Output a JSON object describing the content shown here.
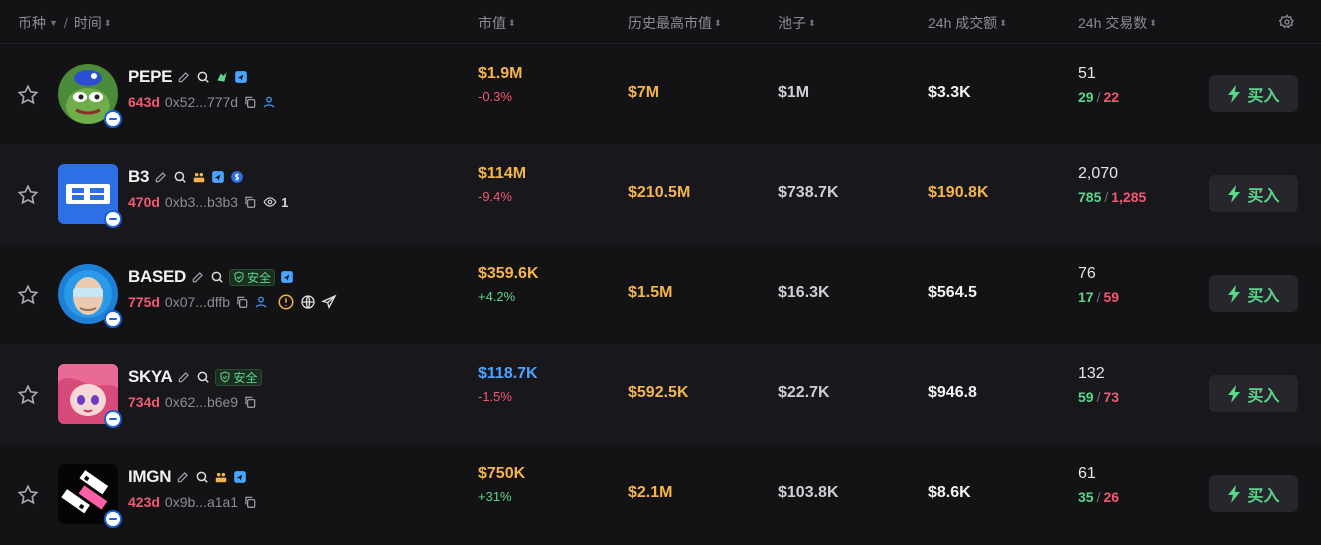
{
  "header": {
    "coin_label": "币种",
    "time_label": "时间",
    "mcap_label": "市值",
    "ath_label": "历史最高市值",
    "pool_label": "池子",
    "vol_label": "24h 成交额",
    "txns_label": "24h 交易数"
  },
  "rows": [
    {
      "symbol": "PEPE",
      "age": "643d",
      "address": "0x52...777d",
      "mcap": "$1.9M",
      "mcap_color": "#f5b54a",
      "change": "-0.3%",
      "change_dir": "down",
      "ath": "$7M",
      "pool": "$1M",
      "volume": "$3.3K",
      "volume_color": "#f2f2f2",
      "txns": "51",
      "buys": "29",
      "sells": "22",
      "buy_label": "买入"
    },
    {
      "symbol": "B3",
      "age": "470d",
      "address": "0xb3...b3b3",
      "watchers": "1",
      "mcap": "$114M",
      "mcap_color": "#f5b54a",
      "change": "-9.4%",
      "change_dir": "down",
      "ath": "$210.5M",
      "pool": "$738.7K",
      "volume": "$190.8K",
      "volume_color": "#f5b54a",
      "txns": "2,070",
      "buys": "785",
      "sells": "1,285",
      "buy_label": "买入"
    },
    {
      "symbol": "BASED",
      "safe_label": "安全",
      "age": "775d",
      "address": "0x07...dffb",
      "mcap": "$359.6K",
      "mcap_color": "#f5b54a",
      "change": "+4.2%",
      "change_dir": "up",
      "ath": "$1.5M",
      "pool": "$16.3K",
      "volume": "$564.5",
      "volume_color": "#f2f2f2",
      "txns": "76",
      "buys": "17",
      "sells": "59",
      "buy_label": "买入"
    },
    {
      "symbol": "SKYA",
      "safe_label": "安全",
      "age": "734d",
      "address": "0x62...b6e9",
      "mcap": "$118.7K",
      "mcap_color": "#4ca3ff",
      "change": "-1.5%",
      "change_dir": "down",
      "ath": "$592.5K",
      "pool": "$22.7K",
      "volume": "$946.8",
      "volume_color": "#f2f2f2",
      "txns": "132",
      "buys": "59",
      "sells": "73",
      "buy_label": "买入"
    },
    {
      "symbol": "IMGN",
      "age": "423d",
      "address": "0x9b...a1a1",
      "mcap": "$750K",
      "mcap_color": "#f5b54a",
      "change": "+31%",
      "change_dir": "up",
      "ath": "$2.1M",
      "pool": "$103.8K",
      "volume": "$8.6K",
      "volume_color": "#f2f2f2",
      "txns": "61",
      "buys": "35",
      "sells": "26",
      "buy_label": "买入"
    }
  ],
  "icons": [
    "star-icon",
    "edit-icon",
    "search-icon",
    "twitter-icon",
    "telegram-icon",
    "dev-team-icon",
    "copy-icon",
    "holder-icon",
    "eye-icon",
    "shield-icon",
    "warning-icon",
    "globe-icon",
    "lightning-icon",
    "gear-icon",
    "chain-badge-icon"
  ]
}
